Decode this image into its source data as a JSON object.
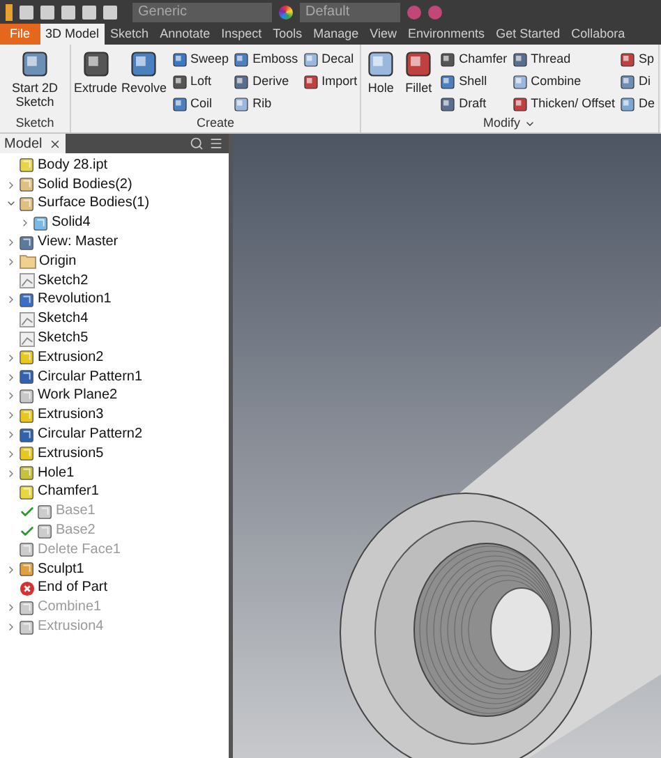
{
  "title_bar": {
    "material": "Generic",
    "appearance": "Default"
  },
  "tabs": [
    {
      "label": "File",
      "kind": "file",
      "selected": false
    },
    {
      "label": "3D Model",
      "kind": "tab",
      "selected": true
    },
    {
      "label": "Sketch",
      "kind": "tab",
      "selected": false
    },
    {
      "label": "Annotate",
      "kind": "tab",
      "selected": false
    },
    {
      "label": "Inspect",
      "kind": "tab",
      "selected": false
    },
    {
      "label": "Tools",
      "kind": "tab",
      "selected": false
    },
    {
      "label": "Manage",
      "kind": "tab",
      "selected": false
    },
    {
      "label": "View",
      "kind": "tab",
      "selected": false
    },
    {
      "label": "Environments",
      "kind": "tab",
      "selected": false
    },
    {
      "label": "Get Started",
      "kind": "tab",
      "selected": false
    },
    {
      "label": "Collabora",
      "kind": "tab",
      "selected": false
    }
  ],
  "ribbon": [
    {
      "label": "Sketch",
      "menu": false,
      "large": [
        "Start 2D Sketch"
      ]
    },
    {
      "label": "Create",
      "menu": false,
      "large": [
        "Extrude",
        "Revolve"
      ],
      "columns": [
        [
          "Sweep",
          "Loft",
          "Coil"
        ],
        [
          "Emboss",
          "Derive",
          "Rib"
        ],
        [
          "Decal",
          "Import"
        ]
      ]
    },
    {
      "label": "Modify",
      "menu": true,
      "large": [
        "Hole",
        "Fillet"
      ],
      "columns": [
        [
          "Chamfer",
          "Shell",
          "Draft"
        ],
        [
          "Thread",
          "Combine",
          "Thicken/ Offset"
        ],
        [
          "Sp",
          "Di",
          "De"
        ]
      ]
    }
  ],
  "browser": {
    "title": "Model",
    "tree": [
      {
        "label": "Body 28.ipt",
        "kind": "part",
        "disabled": false,
        "checked": false
      },
      {
        "label": "Solid Bodies(2)",
        "kind": "bodies",
        "expanded": false,
        "disabled": false,
        "checked": false
      },
      {
        "label": "Surface Bodies(1)",
        "kind": "bodies",
        "expanded": true,
        "disabled": false,
        "checked": false,
        "children": [
          {
            "label": "Solid4",
            "kind": "surface",
            "expanded": false,
            "disabled": false,
            "checked": false
          }
        ]
      },
      {
        "label": "View: Master",
        "kind": "view",
        "expanded": false,
        "disabled": false,
        "checked": false
      },
      {
        "label": "Origin",
        "kind": "folder",
        "expanded": false,
        "disabled": false,
        "checked": false
      },
      {
        "label": "Sketch2",
        "kind": "sketch",
        "disabled": false,
        "checked": false
      },
      {
        "label": "Revolution1",
        "kind": "revolve",
        "expanded": false,
        "disabled": false,
        "checked": false
      },
      {
        "label": "Sketch4",
        "kind": "sketch",
        "disabled": false,
        "checked": false
      },
      {
        "label": "Sketch5",
        "kind": "sketch",
        "disabled": false,
        "checked": false
      },
      {
        "label": "Extrusion2",
        "kind": "extrude",
        "expanded": false,
        "disabled": false,
        "checked": false
      },
      {
        "label": "Circular Pattern1",
        "kind": "pattern",
        "expanded": false,
        "disabled": false,
        "checked": false
      },
      {
        "label": "Work Plane2",
        "kind": "plane",
        "expanded": false,
        "disabled": false,
        "checked": false
      },
      {
        "label": "Extrusion3",
        "kind": "extrude",
        "expanded": false,
        "disabled": false,
        "checked": false
      },
      {
        "label": "Circular Pattern2",
        "kind": "pattern",
        "expanded": false,
        "disabled": false,
        "checked": false
      },
      {
        "label": "Extrusion5",
        "kind": "extrude",
        "expanded": false,
        "disabled": false,
        "checked": false
      },
      {
        "label": "Hole1",
        "kind": "hole",
        "expanded": false,
        "disabled": false,
        "checked": false
      },
      {
        "label": "Chamfer1",
        "kind": "chamfer",
        "disabled": false,
        "checked": false
      },
      {
        "label": "Base1",
        "kind": "base",
        "disabled": true,
        "checked": true
      },
      {
        "label": "Base2",
        "kind": "base",
        "disabled": true,
        "checked": true
      },
      {
        "label": "Delete Face1",
        "kind": "delete",
        "disabled": true,
        "checked": false
      },
      {
        "label": "Sculpt1",
        "kind": "sculpt",
        "expanded": false,
        "disabled": false,
        "checked": false
      },
      {
        "label": "End of Part",
        "kind": "end",
        "disabled": false,
        "checked": false
      },
      {
        "label": "Combine1",
        "kind": "combine",
        "expanded": false,
        "disabled": true,
        "checked": false
      },
      {
        "label": "Extrusion4",
        "kind": "extrude",
        "expanded": false,
        "disabled": true,
        "checked": false
      }
    ]
  }
}
